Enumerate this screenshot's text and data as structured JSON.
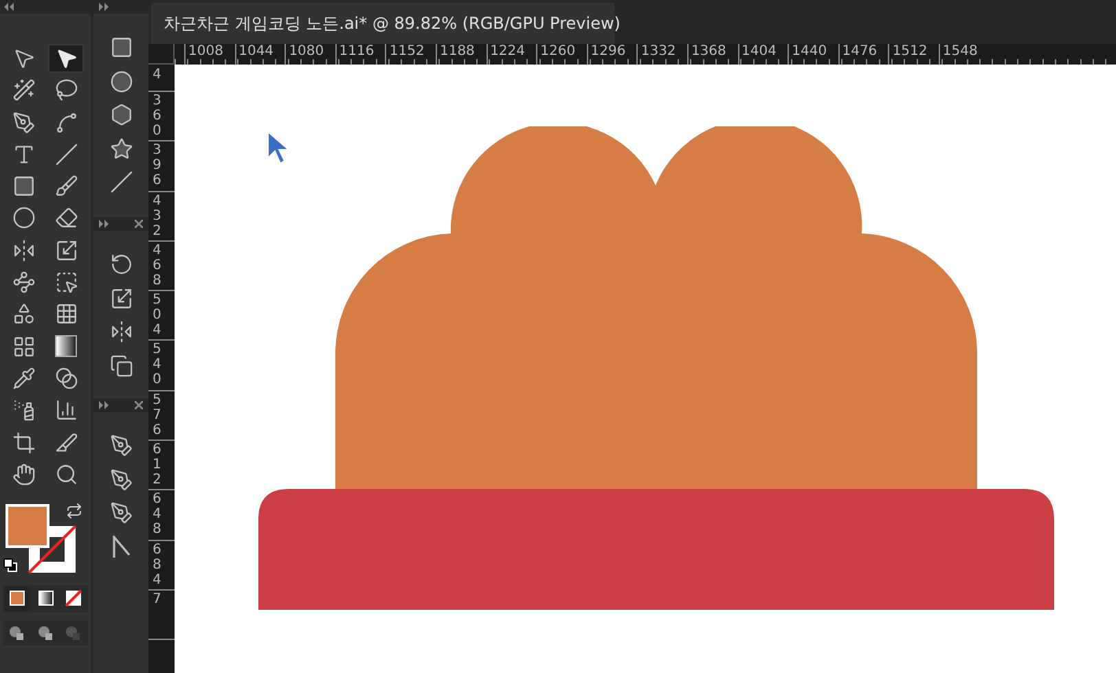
{
  "tools_panel": {
    "tools": [
      {
        "kind": "selection",
        "selected": false
      },
      {
        "kind": "direct-selection",
        "selected": true
      },
      {
        "kind": "magic-wand",
        "selected": false
      },
      {
        "kind": "lasso",
        "selected": false
      },
      {
        "kind": "pen",
        "selected": false
      },
      {
        "kind": "curvature",
        "selected": false
      },
      {
        "kind": "type",
        "selected": false
      },
      {
        "kind": "line",
        "selected": false
      },
      {
        "kind": "rectangle",
        "selected": false
      },
      {
        "kind": "paintbrush",
        "selected": false
      },
      {
        "kind": "shaper",
        "selected": false
      },
      {
        "kind": "eraser",
        "selected": false
      },
      {
        "kind": "reflect",
        "selected": false
      },
      {
        "kind": "scale",
        "selected": false
      },
      {
        "kind": "puppet",
        "selected": false
      },
      {
        "kind": "free-transform",
        "selected": false
      },
      {
        "kind": "shape-builder",
        "selected": false
      },
      {
        "kind": "perspective",
        "selected": false
      },
      {
        "kind": "mesh",
        "selected": false
      },
      {
        "kind": "gradient",
        "selected": false
      },
      {
        "kind": "eyedropper",
        "selected": false
      },
      {
        "kind": "blend",
        "selected": false
      },
      {
        "kind": "sprayer",
        "selected": false
      },
      {
        "kind": "graph",
        "selected": false
      },
      {
        "kind": "artboard",
        "selected": false
      },
      {
        "kind": "slice",
        "selected": false
      },
      {
        "kind": "hand",
        "selected": false
      },
      {
        "kind": "zoom",
        "selected": false
      }
    ]
  },
  "tool_groups": [
    {
      "tools": [
        {
          "kind": "rectangle",
          "selected": false
        },
        {
          "kind": "ellipse",
          "selected": false
        },
        {
          "kind": "polygon",
          "selected": false
        },
        {
          "kind": "star",
          "selected": false
        },
        {
          "kind": "line",
          "selected": false
        }
      ]
    },
    {
      "tools": [
        {
          "kind": "rotate",
          "selected": false
        },
        {
          "kind": "scale",
          "selected": false
        },
        {
          "kind": "reflect",
          "selected": false
        },
        {
          "kind": "shear",
          "selected": false
        }
      ]
    },
    {
      "tools": [
        {
          "kind": "pen",
          "selected": false
        },
        {
          "kind": "add-anchor",
          "selected": false
        },
        {
          "kind": "delete-anchor",
          "selected": false
        },
        {
          "kind": "anchor",
          "selected": false
        }
      ]
    }
  ],
  "document_tab": {
    "title": "차근차근 게임코딩 노든.ai* @ 89.82% (RGB/GPU Preview)"
  },
  "horizontal_ruler": [
    "1008",
    "1044",
    "1080",
    "1116",
    "1152",
    "1188",
    "1224",
    "1260",
    "1296",
    "1332",
    "1368",
    "1404",
    "1440",
    "1476",
    "1512",
    "1548"
  ],
  "vertical_ruler": [
    "4",
    "360",
    "396",
    "432",
    "468",
    "504",
    "540",
    "576",
    "612",
    "648",
    "684",
    "7"
  ]
}
